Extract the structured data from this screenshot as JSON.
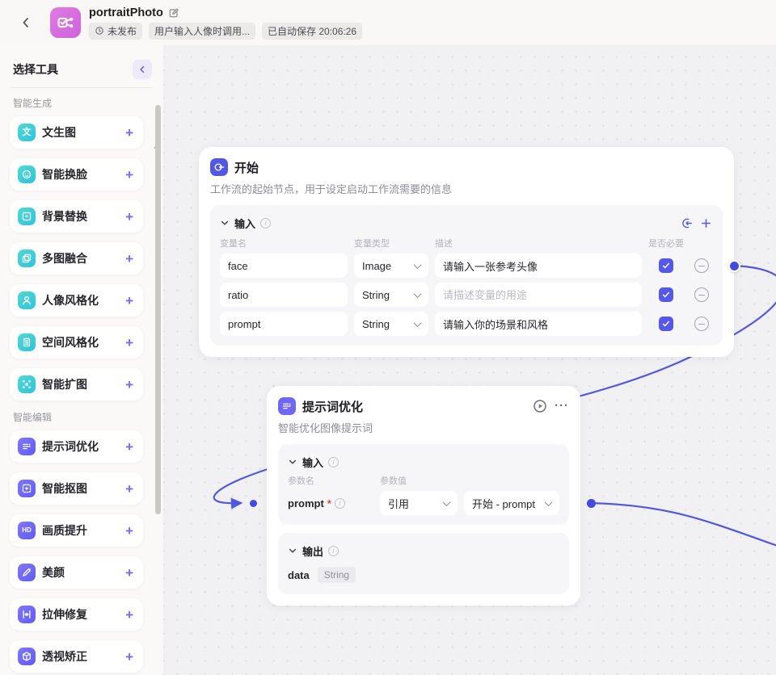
{
  "header": {
    "title": "portraitPhoto",
    "badges": [
      {
        "icon": "clock-icon",
        "label": "未发布"
      },
      {
        "label": "用户输入人像时调用..."
      },
      {
        "label": "已自动保存 20:06:26"
      }
    ]
  },
  "sidebar": {
    "title": "选择工具",
    "sections": [
      {
        "label": "智能生成",
        "theme": "teal",
        "items": [
          {
            "label": "文生图",
            "icon": "text-to-image-icon"
          },
          {
            "label": "智能换脸",
            "icon": "face-swap-icon"
          },
          {
            "label": "背景替换",
            "icon": "background-replace-icon"
          },
          {
            "label": "多图融合",
            "icon": "multi-image-fusion-icon"
          },
          {
            "label": "人像风格化",
            "icon": "portrait-style-icon"
          },
          {
            "label": "空间风格化",
            "icon": "space-style-icon"
          },
          {
            "label": "智能扩图",
            "icon": "outpaint-icon"
          }
        ]
      },
      {
        "label": "智能编辑",
        "theme": "purple",
        "items": [
          {
            "label": "提示词优化",
            "icon": "prompt-optimize-icon"
          },
          {
            "label": "智能抠图",
            "icon": "smart-matting-icon"
          },
          {
            "label": "画质提升",
            "icon": "hd-enhance-icon"
          },
          {
            "label": "美颜",
            "icon": "beauty-icon"
          },
          {
            "label": "拉伸修复",
            "icon": "stretch-fix-icon"
          },
          {
            "label": "透视矫正",
            "icon": "perspective-correct-icon"
          }
        ]
      }
    ]
  },
  "canvas": {
    "nodes": {
      "start": {
        "icon": "start-icon",
        "title": "开始",
        "description": "工作流的起始节点，用于设定启动工作流需要的信息",
        "input_section": {
          "title": "输入",
          "columns": [
            "变量名",
            "变量类型",
            "描述",
            "是否必要"
          ],
          "rows": [
            {
              "name": "face",
              "type": "Image",
              "description": "请输入一张参考头像",
              "description_is_placeholder": false,
              "required": true
            },
            {
              "name": "ratio",
              "type": "String",
              "description": "请描述变量的用途",
              "description_is_placeholder": true,
              "required": true
            },
            {
              "name": "prompt",
              "type": "String",
              "description": "请输入你的场景和风格",
              "description_is_placeholder": false,
              "required": true
            }
          ]
        }
      },
      "prompt_optimizer": {
        "icon": "prompt-optimize-icon",
        "title": "提示词优化",
        "description": "智能优化图像提示词",
        "input_section": {
          "title": "输入",
          "columns": [
            "参数名",
            "参数值"
          ],
          "rows": [
            {
              "name": "prompt",
              "required_mark": "*",
              "mode": "引用",
              "ref": "开始 - prompt"
            }
          ]
        },
        "output_section": {
          "title": "输出",
          "rows": [
            {
              "name": "data",
              "type": "String"
            }
          ]
        }
      }
    }
  },
  "icons": {
    "back": "chevron-left-icon",
    "edit": "edit-icon",
    "collapse": "chevron-left-icon",
    "section_toggle": "chevron-down-icon",
    "info": "info-icon",
    "import": "import-icon",
    "add": "plus-icon",
    "run": "play-icon",
    "more": "ellipsis-icon",
    "remove": "minus-circle-icon",
    "required": "checkbox-checked-icon"
  },
  "colors": {
    "accent_indigo": "#5558E8",
    "connector_blue": "#5157E0",
    "tool_teal": "#3CCBD4",
    "tool_purple": "#6F68F2",
    "app_pink": "#D96FE0",
    "canvas_bg": "#F1F1F3",
    "panel_bg": "#F6F6F8"
  }
}
